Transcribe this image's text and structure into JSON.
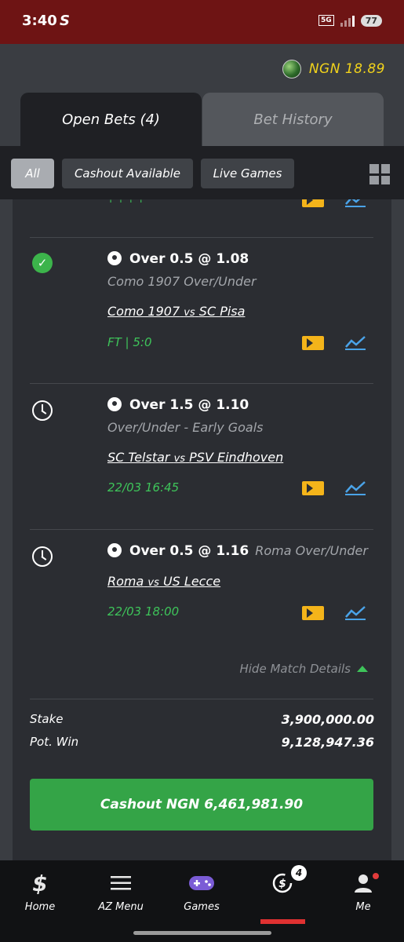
{
  "status_bar": {
    "time": "3:40",
    "app_glyph": "S",
    "network": "5G",
    "battery": "77"
  },
  "balance": {
    "icon": "globe-icon",
    "text": "NGN 18.89"
  },
  "tabs": [
    {
      "label": "Open Bets (4)",
      "active": true
    },
    {
      "label": "Bet History",
      "active": false
    }
  ],
  "filters": [
    {
      "label": "All",
      "active": true
    },
    {
      "label": "Cashout Available",
      "active": false
    },
    {
      "label": "Live Games",
      "active": false
    }
  ],
  "bets": [
    {
      "status": "won",
      "pick": "Over 0.5 @ 1.08",
      "market": "Como 1907 Over/Under",
      "home": "Como 1907",
      "vs": "vs",
      "away": "SC Pisa",
      "time": "FT | 5:0"
    },
    {
      "status": "pending",
      "pick": "Over 1.5 @ 1.10",
      "market": "Over/Under - Early Goals",
      "home": "SC Telstar",
      "vs": "vs",
      "away": "PSV Eindhoven",
      "time": "22/03 16:45"
    },
    {
      "status": "pending",
      "pick": "Over 0.5 @ 1.16",
      "market": "Roma Over/Under",
      "home": "Roma",
      "vs": "vs",
      "away": "US Lecce",
      "time": "22/03 18:00"
    }
  ],
  "hide_details": "Hide Match Details",
  "summary": {
    "stake_label": "Stake",
    "stake_value": "3,900,000.00",
    "potwin_label": "Pot. Win",
    "potwin_value": "9,128,947.36"
  },
  "cashout_label": "Cashout NGN 6,461,981.90",
  "nav": [
    {
      "label": "Home",
      "icon": "s-logo-icon"
    },
    {
      "label": "AZ Menu",
      "icon": "hamburger-icon"
    },
    {
      "label": "Games",
      "icon": "gamepad-icon"
    },
    {
      "label": "",
      "icon": "open-bets-icon",
      "badge": "4"
    },
    {
      "label": "Me",
      "icon": "user-icon"
    }
  ],
  "colors": {
    "status_bar": "#6e1414",
    "accent_green": "#34a447",
    "balance_yellow": "#f2d31b",
    "background": "#3a3d42",
    "card": "#2b2d32"
  }
}
